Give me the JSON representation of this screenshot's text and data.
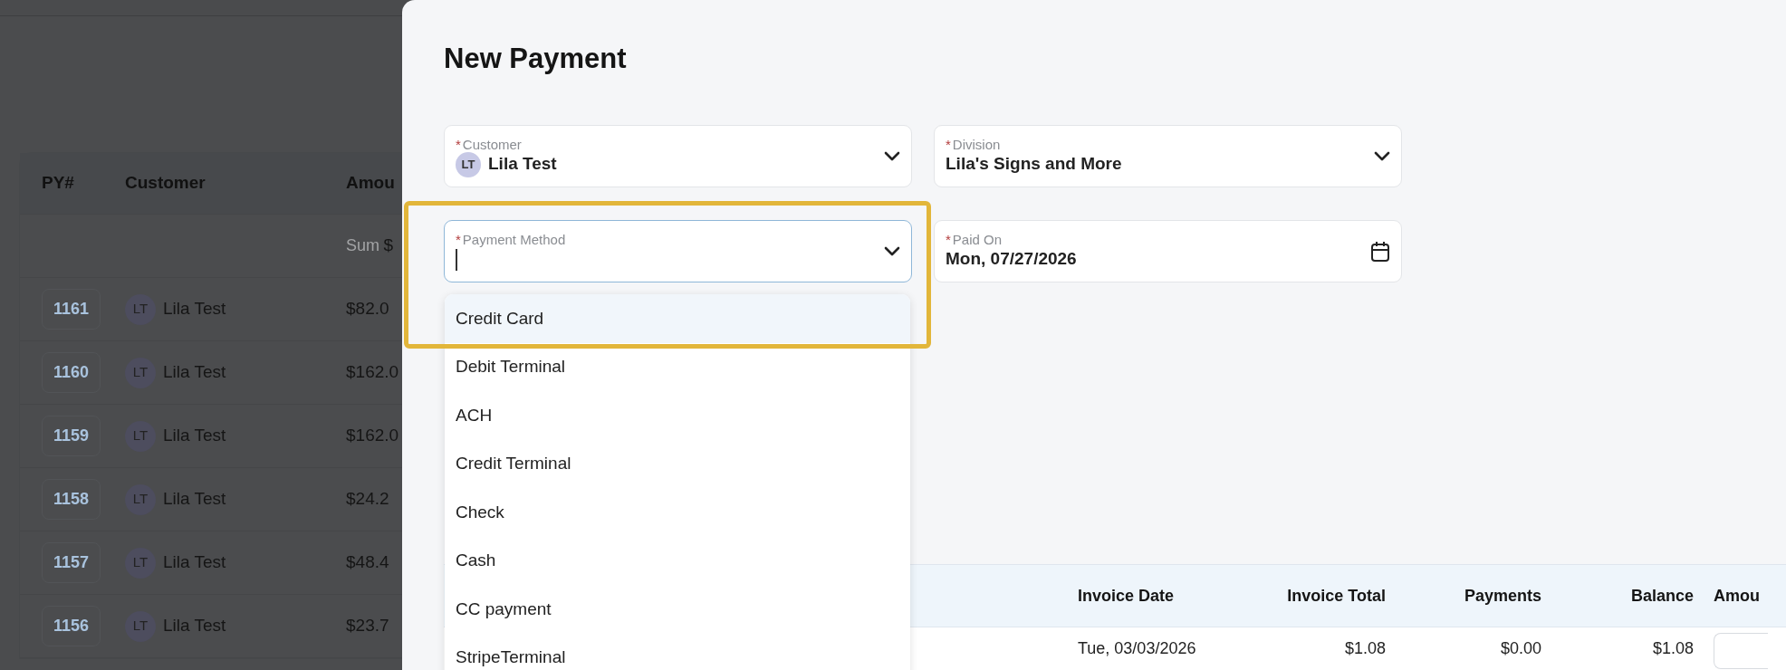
{
  "background_page": {
    "table": {
      "columns": [
        "PY#",
        "Customer",
        "Amou"
      ],
      "sum_row": {
        "label": "Sum",
        "value": "$"
      },
      "rows": [
        {
          "number": "1161",
          "initials": "LT",
          "customer": "Lila Test",
          "amount": "$82.0"
        },
        {
          "number": "1160",
          "initials": "LT",
          "customer": "Lila Test",
          "amount": "$162.0"
        },
        {
          "number": "1159",
          "initials": "LT",
          "customer": "Lila Test",
          "amount": "$162.0"
        },
        {
          "number": "1158",
          "initials": "LT",
          "customer": "Lila Test",
          "amount": "$24.2"
        },
        {
          "number": "1157",
          "initials": "LT",
          "customer": "Lila Test",
          "amount": "$48.4"
        },
        {
          "number": "1156",
          "initials": "LT",
          "customer": "Lila Test",
          "amount": "$23.7"
        }
      ]
    }
  },
  "modal": {
    "title": "New Payment",
    "fields": [
      {
        "kind": "select",
        "mark": "*",
        "label": "Customer",
        "initials": "LT",
        "value": "Lila Test",
        "focused": false
      },
      {
        "kind": "select",
        "mark": "*",
        "label": "Division",
        "value": "Lila's Signs and More",
        "focused": false
      },
      {
        "kind": "select",
        "mark": "*",
        "label": "Payment Method",
        "focused": true
      },
      {
        "kind": "date",
        "mark": "*",
        "label": "Paid On",
        "value": "Mon, 07/27/2026",
        "focused": false
      }
    ],
    "dropdown": {
      "options": [
        {
          "label": "Credit Card",
          "selected": true
        },
        {
          "label": "Debit Terminal",
          "selected": false
        },
        {
          "label": "ACH",
          "selected": false
        },
        {
          "label": "Credit Terminal",
          "selected": false
        },
        {
          "label": "Check",
          "selected": false
        },
        {
          "label": "Cash",
          "selected": false
        },
        {
          "label": "CC payment",
          "selected": false
        },
        {
          "label": "StripeTerminal",
          "selected": false
        }
      ]
    },
    "invoice_table": {
      "columns": [
        "Invoice Date",
        "Invoice Total",
        "Payments",
        "Balance",
        "Amou"
      ],
      "rows": [
        {
          "invoice_date": "Tue, 03/03/2026",
          "invoice_total": "$1.08",
          "payments": "$0.00",
          "balance": "$1.08"
        }
      ]
    }
  }
}
